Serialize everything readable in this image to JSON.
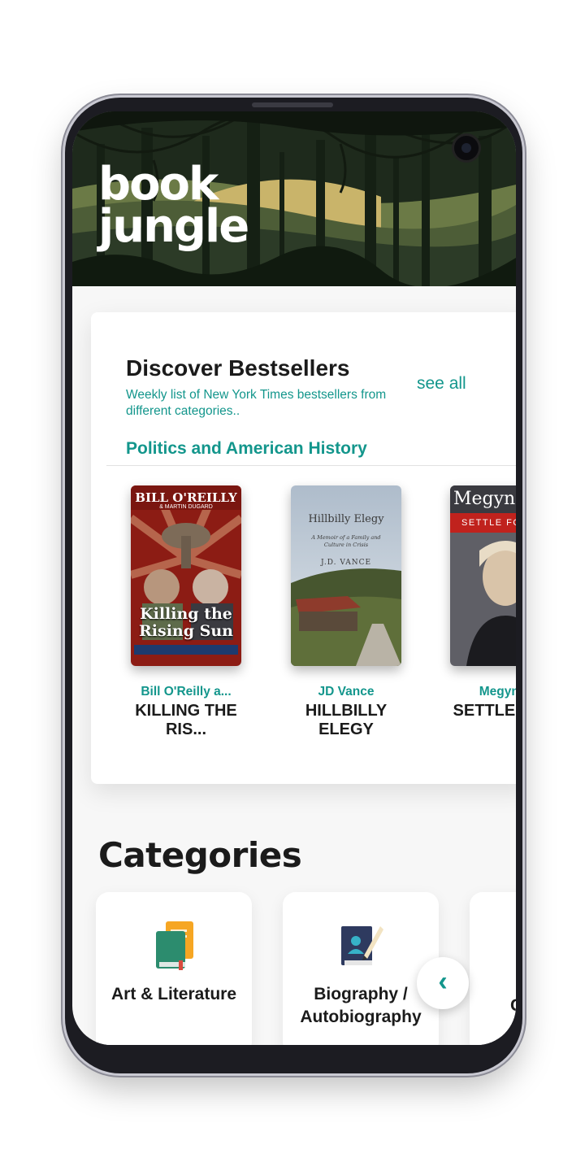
{
  "app": {
    "brand_line1": "book",
    "brand_line2": "jungle"
  },
  "bestsellers": {
    "title": "Discover Bestsellers",
    "subtitle": "Weekly list of New York Times bestsellers from different categories..",
    "see_all": "see all",
    "category": "Politics and American History",
    "books": [
      {
        "author": "Bill O'Reilly a...",
        "title": "KILLING THE RIS...",
        "cover_text": [
          "BILL O'REILLY",
          "& MARTIN DUGARD",
          "Killing the",
          "Rising Sun"
        ]
      },
      {
        "author": "JD Vance",
        "title": "HILLBILLY ELEGY",
        "cover_text": [
          "Hillbilly Elegy",
          "A Memoir of a Family and Culture in Crisis",
          "J.D. VANCE"
        ]
      },
      {
        "author": "Megyn K",
        "title": "SETTLE MOR",
        "cover_text": [
          "Megyn",
          "SETTLE FOR"
        ]
      }
    ]
  },
  "categories": {
    "heading": "Categories",
    "items": [
      {
        "label": "Art & Literature",
        "icon": "books-icon"
      },
      {
        "label": "Biography / Autobiography",
        "icon": "biography-icon"
      },
      {
        "label": "C",
        "icon": "category-icon"
      }
    ]
  },
  "fab": {
    "icon": "chevron-left-icon",
    "glyph": "‹"
  },
  "colors": {
    "accent": "#13968c",
    "header_bg": "#1f2a1c",
    "text": "#1b1b1b"
  }
}
